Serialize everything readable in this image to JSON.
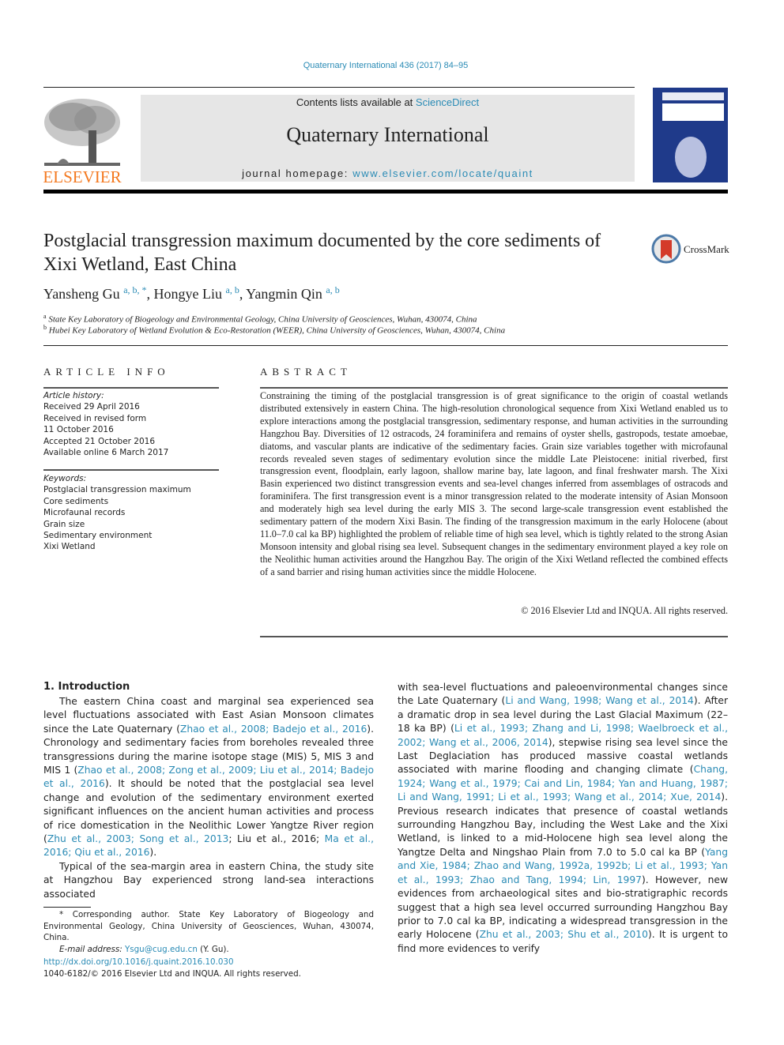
{
  "header": {
    "journal_ref": "Quaternary International 436 (2017) 84–95",
    "contents_prefix": "Contents lists available at ",
    "contents_link": "ScienceDirect",
    "journal_title": "Quaternary International",
    "homepage_prefix": "journal homepage: ",
    "homepage_link": "www.elsevier.com/locate/quaint",
    "publisher_logo_text": "ELSEVIER",
    "crossmark_label": "CrossMark"
  },
  "colors": {
    "link": "#2a8bb5",
    "elsevier_orange": "#f47920",
    "cover_blue": "#1f3a8a",
    "crossmark_red": "#d43b2a"
  },
  "article": {
    "title": "Postglacial transgression maximum documented by the core sediments of Xixi Wetland, East China",
    "authors": [
      {
        "name": "Yansheng Gu",
        "marks": "a, b, *"
      },
      {
        "name": "Hongye Liu",
        "marks": "a, b"
      },
      {
        "name": "Yangmin Qin",
        "marks": "a, b"
      }
    ],
    "affiliations": [
      {
        "mark": "a",
        "text": "State Key Laboratory of Biogeology and Environmental Geology, China University of Geosciences, Wuhan, 430074, China"
      },
      {
        "mark": "b",
        "text": "Hubei Key Laboratory of Wetland Evolution & Eco-Restoration (WEER), China University of Geosciences, Wuhan, 430074, China"
      }
    ]
  },
  "article_info": {
    "heading": "ARTICLE INFO",
    "history_label": "Article history:",
    "history": [
      "Received 29 April 2016",
      "Received in revised form",
      "11 October 2016",
      "Accepted 21 October 2016",
      "Available online 6 March 2017"
    ],
    "keywords_label": "Keywords:",
    "keywords": [
      "Postglacial transgression maximum",
      "Core sediments",
      "Microfaunal records",
      "Grain size",
      "Sedimentary environment",
      "Xixi Wetland"
    ]
  },
  "abstract": {
    "heading": "ABSTRACT",
    "text": "Constraining the timing of the postglacial transgression is of great significance to the origin of coastal wetlands distributed extensively in eastern China. The high-resolution chronological sequence from Xixi Wetland enabled us to explore interactions among the postglacial transgression, sedimentary response, and human activities in the surrounding Hangzhou Bay. Diversities of 12 ostracods, 24 foraminifera and remains of oyster shells, gastropods, testate amoebae, diatoms, and vascular plants are indicative of the sedimentary facies. Grain size variables together with microfaunal records revealed seven stages of sedimentary evolution since the middle Late Pleistocene: initial riverbed, first transgression event, floodplain, early lagoon, shallow marine bay, late lagoon, and final freshwater marsh. The Xixi Basin experienced two distinct transgression events and sea-level changes inferred from assemblages of ostracods and foraminifera. The first transgression event is a minor transgression related to the moderate intensity of Asian Monsoon and moderately high sea level during the early MIS 3. The second large-scale transgression event established the sedimentary pattern of the modern Xixi Basin. The finding of the transgression maximum in the early Holocene (about 11.0–7.0 cal ka BP) highlighted the problem of reliable time of high sea level, which is tightly related to the strong Asian Monsoon intensity and global rising sea level. Subsequent changes in the sedimentary environment played a key role on the Neolithic human activities around the Hangzhou Bay. The origin of the Xixi Wetland reflected the combined effects of a sand barrier and rising human activities since the middle Holocene.",
    "copyright": "© 2016 Elsevier Ltd and INQUA. All rights reserved."
  },
  "introduction": {
    "heading": "1.  Introduction",
    "p1": [
      {
        "t": "The eastern China coast and marginal sea experienced sea level fluctuations associated with East Asian Monsoon climates since the Late Quaternary ("
      },
      {
        "t": "Zhao et al., 2008; Badejo et al., 2016",
        "link": true
      },
      {
        "t": "). Chronology and sedimentary facies from boreholes revealed three transgressions during the marine isotope stage (MIS) 5, MIS 3 and MIS 1 ("
      },
      {
        "t": "Zhao et al., 2008; Zong et al., 2009; Liu et al., 2014; Badejo et al., 2016",
        "link": true
      },
      {
        "t": "). It should be noted that the postglacial sea level change and evolution of the sedimentary environment exerted significant influences on the ancient human activities and process of rice domestication in the Neolithic Lower Yangtze River region ("
      },
      {
        "t": "Zhu et al., 2003; Song et al., 2013",
        "link": true
      },
      {
        "t": "; Liu et al., 2016; "
      },
      {
        "t": "Ma et al., 2016; Qiu et al., 2016",
        "link": true
      },
      {
        "t": ")."
      }
    ],
    "p2": [
      {
        "t": "Typical of the sea-margin area in eastern China, the study site at Hangzhou Bay experienced strong land-sea interactions associated with sea-level fluctuations and paleoenvironmental changes since the Late Quaternary ("
      },
      {
        "t": "Li and Wang, 1998; Wang et al., 2014",
        "link": true
      },
      {
        "t": "). After a dramatic drop in sea level during the Last Glacial Maximum (22–18 ka BP) ("
      },
      {
        "t": "Li et al., 1993; Zhang and Li, 1998; Waelbroeck et al., 2002; Wang et al., 2006, 2014",
        "link": true
      },
      {
        "t": "), stepwise rising sea level since the Last Deglaciation has produced massive coastal wetlands associated with marine flooding and changing climate ("
      },
      {
        "t": "Chang, 1924; Wang et al., 1979; Cai and Lin, 1984; Yan and Huang, 1987; Li and Wang, 1991; Li et al., 1993; Wang et al., 2014; Xue, 2014",
        "link": true
      },
      {
        "t": "). Previous research indicates that presence of coastal wetlands surrounding Hangzhou Bay, including the West Lake and the Xixi Wetland, is linked to a mid-Holocene high sea level along the Yangtze Delta and Ningshao Plain from 7.0 to 5.0 cal ka BP ("
      },
      {
        "t": "Yang and Xie, 1984; Zhao and Wang, 1992a, 1992b; Li et al., 1993; Yan et al., 1993; Zhao and Tang, 1994; Lin, 1997",
        "link": true
      },
      {
        "t": "). However, new evidences from archaeological sites and bio-stratigraphic records suggest that a high sea level occurred surrounding Hangzhou Bay prior to 7.0 cal ka BP, indicating a widespread transgression in the early Holocene ("
      },
      {
        "t": "Zhu et al., 2003; Shu et al., 2010",
        "link": true
      },
      {
        "t": "). It is urgent to find more evidences to verify"
      }
    ]
  },
  "footnote": {
    "corresponding": "* Corresponding author. State Key Laboratory of Biogeology and Environmental Geology, China University of Geosciences, Wuhan, 430074, China.",
    "email_label": "E-mail address: ",
    "email": "Ysgu@cug.edu.cn",
    "email_suffix": " (Y. Gu).",
    "doi": "http://dx.doi.org/10.1016/j.quaint.2016.10.030",
    "issn": "1040-6182/© 2016 Elsevier Ltd and INQUA. All rights reserved."
  }
}
